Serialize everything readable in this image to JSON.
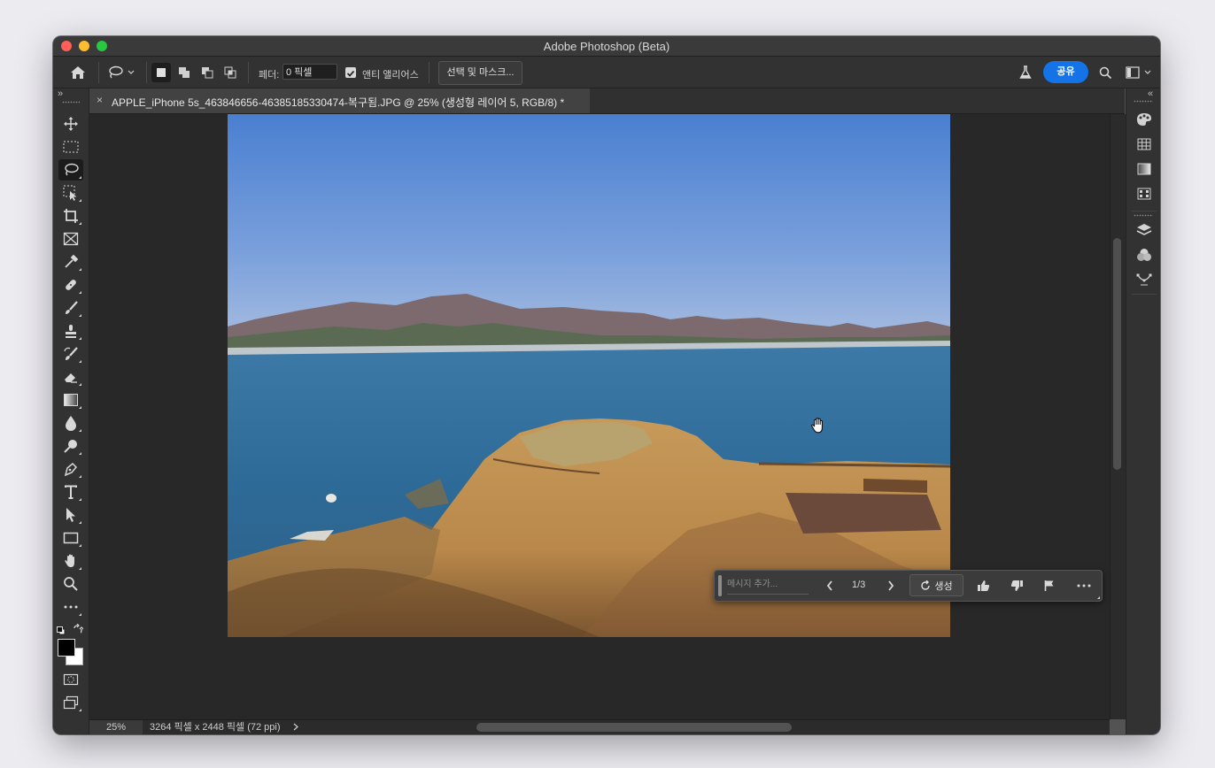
{
  "window": {
    "title": "Adobe Photoshop (Beta)"
  },
  "options_bar": {
    "feather_label": "페더:",
    "feather_value": "0 픽셀",
    "anti_alias_label": "앤티 앨리어스",
    "anti_alias_checked": true,
    "select_mask_label": "선택 및 마스크...",
    "share_label": "공유"
  },
  "document": {
    "tab_title": "APPLE_iPhone 5s_463846656-46385185330474-복구됨.JPG @ 25% (생성형 레이어 5, RGB/8) *"
  },
  "status_bar": {
    "zoom": "25%",
    "doc_info": "3264 픽셀 x 2448 픽셀 (72 ppi)"
  },
  "contextual_task_bar": {
    "message_placeholder": "메시지 추가...",
    "page": "1/3",
    "generate_label": "생성"
  },
  "icons": {
    "toolbar": [
      "move-icon",
      "marquee-icon",
      "lasso-icon",
      "object-selection-icon",
      "crop-icon",
      "frame-icon",
      "eyedropper-icon",
      "healing-brush-icon",
      "brush-icon",
      "clone-stamp-icon",
      "history-brush-icon",
      "eraser-icon",
      "gradient-icon",
      "blur-icon",
      "dodge-icon",
      "pen-icon",
      "type-icon",
      "path-selection-icon",
      "rectangle-icon",
      "hand-icon",
      "zoom-icon",
      "more-tools-icon"
    ],
    "right_panels": [
      "color-icon",
      "swatches-icon",
      "gradients-icon",
      "patterns-icon",
      "layers-icon",
      "channels-icon",
      "paths-icon"
    ]
  },
  "colors": {
    "accent": "#1473e6",
    "foreground": "#000000",
    "background": "#ffffff"
  }
}
